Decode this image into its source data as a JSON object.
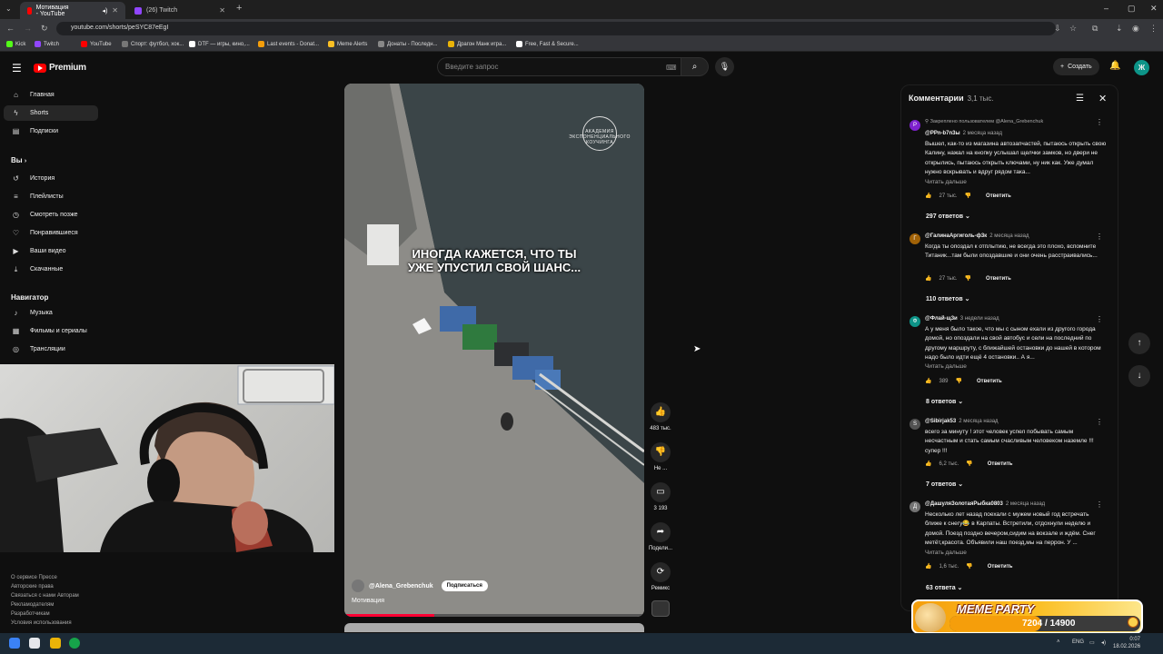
{
  "browser": {
    "tabs": [
      {
        "title": "Мотивация - YouTube",
        "active": true
      },
      {
        "title": "(26) Twitch",
        "active": false
      }
    ],
    "url": "youtube.com/shorts/peSYC87eEgI",
    "bookmarks": [
      "Kick",
      "Twitch",
      "YouTube",
      "Спорт: футбол, хок...",
      "DTF — игры, кино,...",
      "Last events - Donat...",
      "Meme Alerts",
      "Донаты - Последн...",
      "Драгон Манк игра...",
      "Free, Fast & Secure..."
    ]
  },
  "header": {
    "logo": "Premium",
    "search_placeholder": "Введите запрос",
    "create_label": "Создать",
    "avatar_letter": "Ж"
  },
  "sidebar": {
    "main": [
      {
        "label": "Главная",
        "icon": "home-icon"
      },
      {
        "label": "Shorts",
        "icon": "shorts-icon",
        "active": true
      },
      {
        "label": "Подписки",
        "icon": "subscriptions-icon"
      }
    ],
    "you_header": "Вы",
    "you": [
      {
        "label": "История",
        "icon": "history-icon"
      },
      {
        "label": "Плейлисты",
        "icon": "playlists-icon"
      },
      {
        "label": "Смотреть позже",
        "icon": "watch-later-icon"
      },
      {
        "label": "Понравившиеся",
        "icon": "liked-icon"
      },
      {
        "label": "Ваши видео",
        "icon": "your-videos-icon"
      },
      {
        "label": "Скачанные",
        "icon": "downloads-icon"
      }
    ],
    "nav_header": "Навигатор",
    "nav": [
      {
        "label": "Музыка",
        "icon": "music-icon"
      },
      {
        "label": "Фильмы и сериалы",
        "icon": "movies-icon"
      },
      {
        "label": "Трансляции",
        "icon": "live-icon"
      }
    ],
    "footer_lines": [
      "О сервисе  Прессе",
      "Авторские права",
      "Связаться с нами  Авторам",
      "Рекламодателям",
      "Разработчикам",
      "",
      "Условия использования"
    ]
  },
  "video": {
    "caption": "ИНОГДА КАЖЕТСЯ, ЧТО ТЫ УЖЕ УПУСТИЛ СВОЙ ШАНС...",
    "channel": "@Alena_Grebenchuk",
    "subscribe_label": "Подписаться",
    "title": "Мотивация",
    "watermark": "АКАДЕМИЯ ЭКСПОНЕНЦИАЛЬНОГО КОУЧИНГА",
    "progress_fraction": 0.3
  },
  "actions": [
    {
      "label": "483 тыс.",
      "icon": "like-icon"
    },
    {
      "label": "Не ...",
      "icon": "dislike-icon"
    },
    {
      "label": "3 193",
      "icon": "comment-icon"
    },
    {
      "label": "Подели...",
      "icon": "share-icon"
    },
    {
      "label": "Ремикс",
      "icon": "remix-icon"
    }
  ],
  "comments": {
    "title": "Комментарии",
    "count": "3,1 тыс.",
    "items": [
      {
        "pinned": "Закреплено пользователем @Alena_Grebenchuk",
        "user": "@PPn-b7n3ы",
        "time": "2 месяца назад",
        "avatar_letter": "P",
        "avatar_color": "#7e22ce",
        "text": "Вышел, как-то из магазина автозапчастей, пытаюсь открыть свою Калину, нажал на кнопку услышал щелчки замков, но двери не открылись, пытаюсь открыть ключами, ну ник как. Уже думал нужно вскрывать и вдруг рядом така...",
        "more": "Читать дальше",
        "likes": "27 тыс.",
        "reply": "Ответить",
        "replies": "297 ответов"
      },
      {
        "user": "@ГалинаАргиголь-ф3к",
        "time": "2 месяца назад",
        "avatar_letter": "Г",
        "avatar_color": "#a16207",
        "text": "Когда ты опоздал к отплытию, не всегда это плохо, вспомните Титаник...там были опоздавшие и они очень расстраивались...",
        "likes": "27 тыс.",
        "reply": "Ответить",
        "replies": "110 ответов"
      },
      {
        "user": "@Флай-щ3и",
        "time": "3 недели назад",
        "avatar_letter": "Ф",
        "avatar_color": "#0d9488",
        "text": "А у меня было такое, что мы с сыном ехали из другого города домой, но опоздали на свой автобус и сели на последний по другому маршруту, с ближайшей остановки до нашей в котором надо было идти ещё 4 остановки.. А я...",
        "more": "Читать дальше",
        "likes": "389",
        "reply": "Ответить",
        "replies": "8 ответов"
      },
      {
        "user": "@Sibirjak53",
        "time": "2 месяца назад",
        "avatar_letter": "S",
        "avatar_color": "#525252",
        "text": "всего за минуту ! этот человек успел побывать самым несчастным и стать самым счасливым человеком наземле !!! супер !!!",
        "likes": "6,2 тыс.",
        "reply": "Ответить",
        "replies": "7 ответов"
      },
      {
        "user": "@ДашуляЗолотаяРыбка0803",
        "time": "2 месяца назад",
        "avatar_letter": "Д",
        "avatar_color": "#737373",
        "text": "Несколько лет назад поехали с мужем новый год встречать ближе к снегу😂 в Карпаты. Встретили, отдохнули неделю и домой. Поезд поздно вечером,сидим на вокзале и ждём. Снег метёт,красота. Объявили наш поезд,мы на перрон. У ...",
        "more": "Читать дальше",
        "likes": "1,6 тыс.",
        "reply": "Ответить",
        "replies": "63 ответа"
      }
    ]
  },
  "overlay": {
    "title": "MEME PARTY",
    "value": "7204 / 14900",
    "progress_fraction": 0.48
  },
  "taskbar": {
    "lang": "ENG",
    "time": "0:07",
    "date": "18.02.2026"
  }
}
